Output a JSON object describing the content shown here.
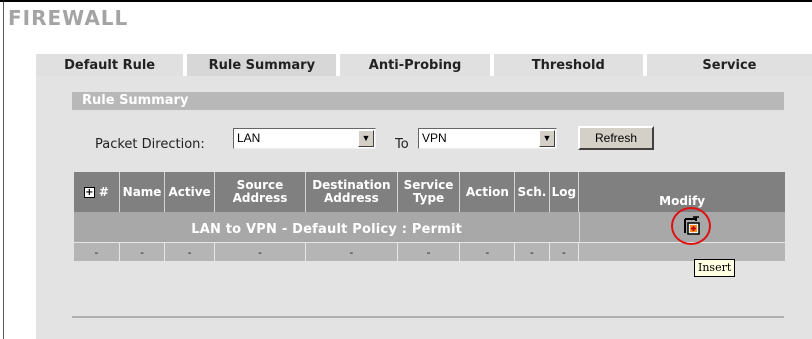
{
  "page_title": "FIREWALL",
  "tabs": [
    {
      "label": "Default Rule",
      "active": false
    },
    {
      "label": "Rule Summary",
      "active": true
    },
    {
      "label": "Anti-Probing",
      "active": false
    },
    {
      "label": "Threshold",
      "active": false
    },
    {
      "label": "Service",
      "active": false
    }
  ],
  "section_title": "Rule Summary",
  "packet_direction": {
    "label": "Packet Direction:",
    "from_value": "LAN",
    "to_label": "To",
    "to_value": "VPN"
  },
  "refresh_label": "Refresh",
  "table": {
    "headers": {
      "num": "#",
      "name": "Name",
      "active": "Active",
      "source": "Source Address",
      "destination": "Destination Address",
      "service": "Service Type",
      "action": "Action",
      "sch": "Sch.",
      "log": "Log",
      "modify": "Modify"
    },
    "policy_text": "LAN to VPN - Default Policy : Permit",
    "empty_cell": "-"
  },
  "tooltip": "Insert",
  "icons": {
    "expand": "plus-box-icon",
    "insert": "insert-rule-icon"
  },
  "colors": {
    "header_bg": "#808080",
    "highlight": "#e01010"
  }
}
